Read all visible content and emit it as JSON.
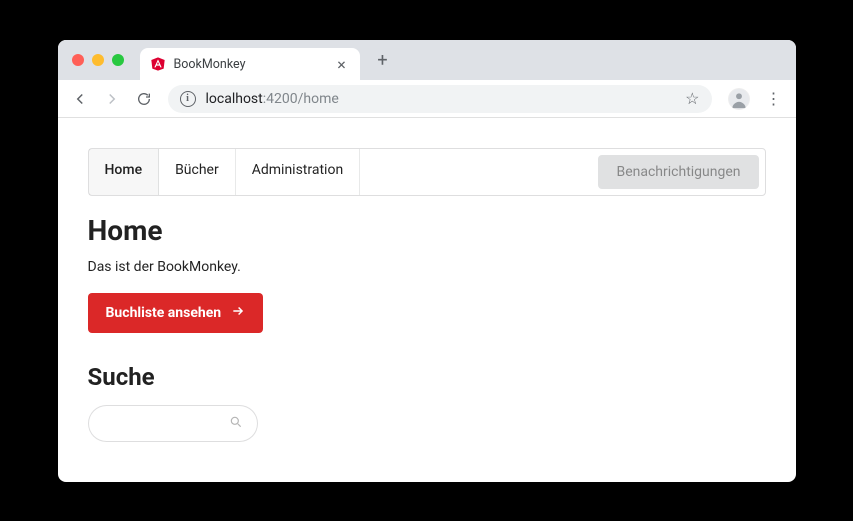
{
  "browser": {
    "tab_title": "BookMonkey",
    "url_host": "localhost",
    "url_port_path": ":4200/home"
  },
  "nav": {
    "items": [
      {
        "label": "Home",
        "active": true
      },
      {
        "label": "Bücher",
        "active": false
      },
      {
        "label": "Administration",
        "active": false
      }
    ],
    "notifications_label": "Benachrichtigungen"
  },
  "home": {
    "title": "Home",
    "intro": "Das ist der BookMonkey.",
    "button_label": "Buchliste ansehen"
  },
  "search": {
    "title": "Suche",
    "placeholder": ""
  }
}
